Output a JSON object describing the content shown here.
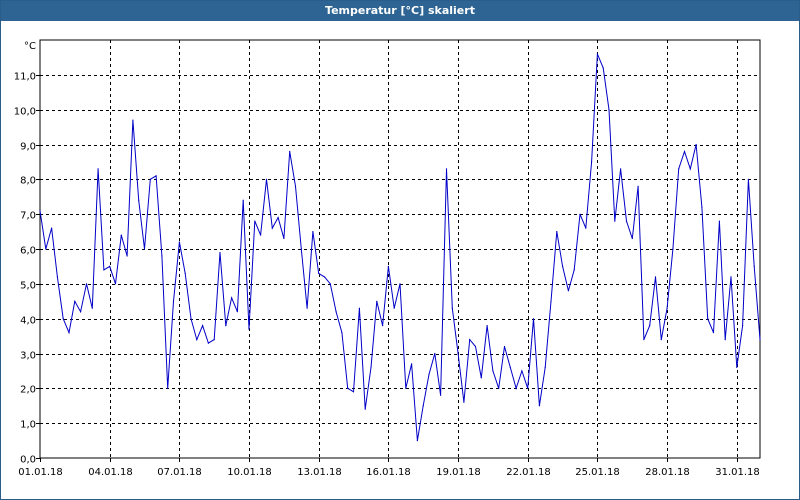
{
  "window": {
    "title": "Temperatur [°C] skaliert"
  },
  "chart_data": {
    "type": "line",
    "title": "Temperatur [°C] skaliert",
    "ylabel": "°C",
    "xlabel": "",
    "ylim": [
      0,
      12
    ],
    "xlim": [
      "01.01.18",
      "01.02.18"
    ],
    "grid": true,
    "line_color": "#0000c8",
    "y_ticks": [
      "0,0",
      "1,0",
      "2,0",
      "3,0",
      "4,0",
      "5,0",
      "6,0",
      "7,0",
      "8,0",
      "9,0",
      "10,0",
      "11,0"
    ],
    "x_ticks": [
      "01.01.18",
      "04.01.18",
      "07.01.18",
      "10.01.18",
      "13.01.18",
      "16.01.18",
      "19.01.18",
      "22.01.18",
      "25.01.18",
      "28.01.18",
      "31.01.18"
    ],
    "series": [
      {
        "x": [
          "01.01.18 00:00",
          "01.01.18 06:00",
          "01.01.18 12:00",
          "01.01.18 18:00",
          "02.01.18 00:00",
          "02.01.18 06:00",
          "02.01.18 12:00",
          "02.01.18 18:00",
          "03.01.18 00:00",
          "03.01.18 06:00",
          "03.01.18 12:00",
          "03.01.18 18:00",
          "04.01.18 00:00",
          "04.01.18 06:00",
          "04.01.18 12:00",
          "04.01.18 18:00",
          "05.01.18 00:00",
          "05.01.18 06:00",
          "05.01.18 12:00",
          "05.01.18 18:00",
          "06.01.18 00:00",
          "06.01.18 06:00",
          "06.01.18 12:00",
          "06.01.18 18:00",
          "07.01.18 00:00",
          "07.01.18 06:00",
          "07.01.18 12:00",
          "07.01.18 18:00",
          "08.01.18 00:00",
          "08.01.18 06:00",
          "08.01.18 12:00",
          "08.01.18 18:00",
          "09.01.18 00:00",
          "09.01.18 06:00",
          "09.01.18 12:00",
          "09.01.18 18:00",
          "10.01.18 00:00",
          "10.01.18 06:00",
          "10.01.18 12:00",
          "10.01.18 18:00",
          "11.01.18 00:00",
          "11.01.18 06:00",
          "11.01.18 12:00",
          "11.01.18 18:00",
          "12.01.18 00:00",
          "12.01.18 06:00",
          "12.01.18 12:00",
          "12.01.18 18:00",
          "13.01.18 00:00",
          "13.01.18 06:00",
          "13.01.18 12:00",
          "13.01.18 18:00",
          "14.01.18 00:00",
          "14.01.18 06:00",
          "14.01.18 12:00",
          "14.01.18 18:00",
          "15.01.18 00:00",
          "15.01.18 06:00",
          "15.01.18 12:00",
          "15.01.18 18:00",
          "16.01.18 00:00",
          "16.01.18 06:00",
          "16.01.18 12:00",
          "16.01.18 18:00",
          "17.01.18 00:00",
          "17.01.18 06:00",
          "17.01.18 12:00",
          "17.01.18 18:00",
          "18.01.18 00:00",
          "18.01.18 06:00",
          "18.01.18 12:00",
          "18.01.18 18:00",
          "19.01.18 00:00",
          "19.01.18 06:00",
          "19.01.18 12:00",
          "19.01.18 18:00",
          "20.01.18 00:00",
          "20.01.18 06:00",
          "20.01.18 12:00",
          "20.01.18 18:00",
          "21.01.18 00:00",
          "21.01.18 06:00",
          "21.01.18 12:00",
          "21.01.18 18:00",
          "22.01.18 00:00",
          "22.01.18 06:00",
          "22.01.18 12:00",
          "22.01.18 18:00",
          "23.01.18 00:00",
          "23.01.18 06:00",
          "23.01.18 12:00",
          "23.01.18 18:00",
          "24.01.18 00:00",
          "24.01.18 06:00",
          "24.01.18 12:00",
          "24.01.18 18:00",
          "25.01.18 00:00",
          "25.01.18 06:00",
          "25.01.18 12:00",
          "25.01.18 18:00",
          "26.01.18 00:00",
          "26.01.18 06:00",
          "26.01.18 12:00",
          "26.01.18 18:00",
          "27.01.18 00:00",
          "27.01.18 06:00",
          "27.01.18 12:00",
          "27.01.18 18:00",
          "28.01.18 00:00",
          "28.01.18 06:00",
          "28.01.18 12:00",
          "28.01.18 18:00",
          "29.01.18 00:00",
          "29.01.18 06:00",
          "29.01.18 12:00",
          "29.01.18 18:00",
          "30.01.18 00:00",
          "30.01.18 06:00",
          "30.01.18 12:00",
          "30.01.18 18:00",
          "31.01.18 00:00",
          "31.01.18 06:00",
          "31.01.18 12:00",
          "31.01.18 18:00",
          "01.02.18 00:00"
        ],
        "values": [
          7.1,
          6.0,
          6.6,
          5.2,
          4.0,
          3.6,
          4.5,
          4.2,
          5.0,
          4.3,
          8.3,
          5.4,
          5.5,
          5.0,
          6.4,
          5.8,
          9.7,
          7.4,
          6.0,
          8.0,
          8.1,
          5.8,
          2.0,
          4.5,
          6.2,
          5.3,
          4.0,
          3.4,
          3.8,
          3.3,
          3.4,
          5.9,
          3.8,
          4.6,
          4.2,
          7.4,
          3.7,
          6.8,
          6.4,
          8.0,
          6.6,
          6.9,
          6.3,
          8.8,
          7.8,
          6.0,
          4.3,
          6.5,
          5.3,
          5.2,
          5.0,
          4.2,
          3.6,
          2.0,
          1.9,
          4.3,
          1.4,
          2.6,
          4.5,
          3.8,
          5.5,
          4.3,
          5.0,
          2.0,
          2.7,
          0.5,
          1.5,
          2.4,
          3.0,
          1.8,
          8.3,
          4.3,
          3.0,
          1.6,
          3.4,
          3.2,
          2.3,
          3.8,
          2.5,
          2.0,
          3.2,
          2.6,
          2.0,
          2.5,
          2.0,
          4.0,
          1.5,
          2.6,
          4.5,
          6.5,
          5.5,
          4.8,
          5.4,
          7.0,
          6.6,
          8.5,
          11.6,
          11.2,
          10.0,
          6.8,
          8.3,
          6.8,
          6.3,
          7.8,
          3.4,
          3.8,
          5.2,
          3.4,
          4.3,
          6.0,
          8.3,
          8.8,
          8.3,
          9.0,
          7.2,
          4.0,
          3.6,
          6.8,
          3.4,
          5.2,
          2.6,
          3.8,
          8.0,
          5.5,
          3.4
        ]
      }
    ]
  }
}
